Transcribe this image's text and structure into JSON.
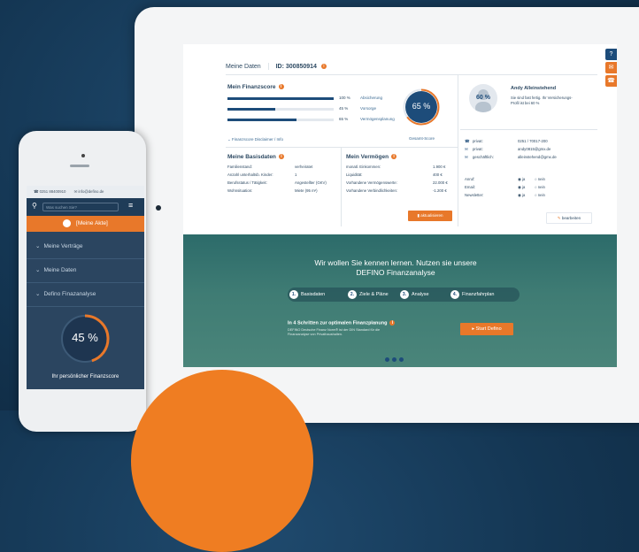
{
  "tablet": {
    "header": {
      "title": "Meine Daten",
      "id_label": "ID: 300850914"
    },
    "score": {
      "title": "Mein Finanzscore",
      "rows": [
        {
          "pct": "100 %",
          "label": "Absicherung",
          "fill": 100
        },
        {
          "pct": "45 %",
          "label": "Vorsorge",
          "fill": 45
        },
        {
          "pct": "65 %",
          "label": "Vermögensplanung",
          "fill": 65
        }
      ],
      "total": "65 %",
      "total_label": "Gesamt-Score",
      "disclaimer": "Finanzscore Disclaimer / Info"
    },
    "profile": {
      "name": "Andy Alleinstehend",
      "gauge": "60 %",
      "note": "Sie sind fast fertig. Ihr Versicherungs-Profil ist bei 60 %",
      "contacts": [
        {
          "k": "privat:",
          "v": "0251 / 70017-200"
        },
        {
          "k": "privat:",
          "v": "andy0815@gmx.de"
        },
        {
          "k": "geschäftlich:",
          "v": "alleinstehend@gmx.de"
        }
      ],
      "prefs": [
        {
          "k": "Anruf:",
          "ja": "ja",
          "nein": "nein"
        },
        {
          "k": "Email:",
          "ja": "ja",
          "nein": "nein"
        },
        {
          "k": "Newsletter:",
          "ja": "ja",
          "nein": "nein"
        }
      ],
      "edit_button": "bearbeiten"
    },
    "basis": {
      "title": "Meine Basisdaten",
      "rows": [
        {
          "k": "Familienstand:",
          "v": "verheiratet"
        },
        {
          "k": "Anzahl unterhaltsb. Kinder:",
          "v": "1"
        },
        {
          "k": "Berufsstatus / Tätigkeit:",
          "v": "Angestellter (GKV)"
        },
        {
          "k": "Wohnsituation:",
          "v": "Miete (95 m²)"
        }
      ]
    },
    "vermoegen": {
      "title": "Mein Vermögen",
      "rows": [
        {
          "k": "monatl. Einkommen:",
          "v": "1.900 €"
        },
        {
          "k": "Liquidität:",
          "v": "400 €"
        },
        {
          "k": "Vorhandene Vermögenswerte:",
          "v": "22.000 €"
        },
        {
          "k": "Vorhandene Verbindlichkeiten:",
          "v": "-1.200 €"
        }
      ],
      "update_button": "aktualisieren"
    },
    "hero": {
      "title": "Wir wollen Sie kennen lernen. Nutzen sie unsere DEFINO Finanzanalyse",
      "steps": [
        {
          "n": "1.",
          "label": "Basisdaten"
        },
        {
          "n": "2.",
          "label": "Ziele & Pläne"
        },
        {
          "n": "3.",
          "label": "Analyse"
        },
        {
          "n": "4.",
          "label": "Finanzfahrplan"
        }
      ],
      "subtitle": "In 4 Schritten zur optimalen Finanzplanung",
      "text": "DEFINO Deutsche Finanz Norm® ist der DIN Standard für die Finanzanalyse von Privathaushalten.",
      "cta": "Start Defino"
    },
    "side_icons": [
      "help-icon",
      "mail-icon",
      "phone-icon"
    ],
    "accent": "#e8782a",
    "navy": "#1d4c7a"
  },
  "phone": {
    "phone_number": "0251 88400910",
    "email": "info@defino.de",
    "search_placeholder": "Was suchen Sie?",
    "akte": "[Meine Akte]",
    "menu": [
      {
        "label": "Meine Verträge"
      },
      {
        "label": "Meine Daten"
      },
      {
        "label": "Defino Finazanalyse"
      }
    ],
    "score": "45 %",
    "score_fill": 45,
    "score_label": "Ihr persönlicher Finanzscore"
  }
}
